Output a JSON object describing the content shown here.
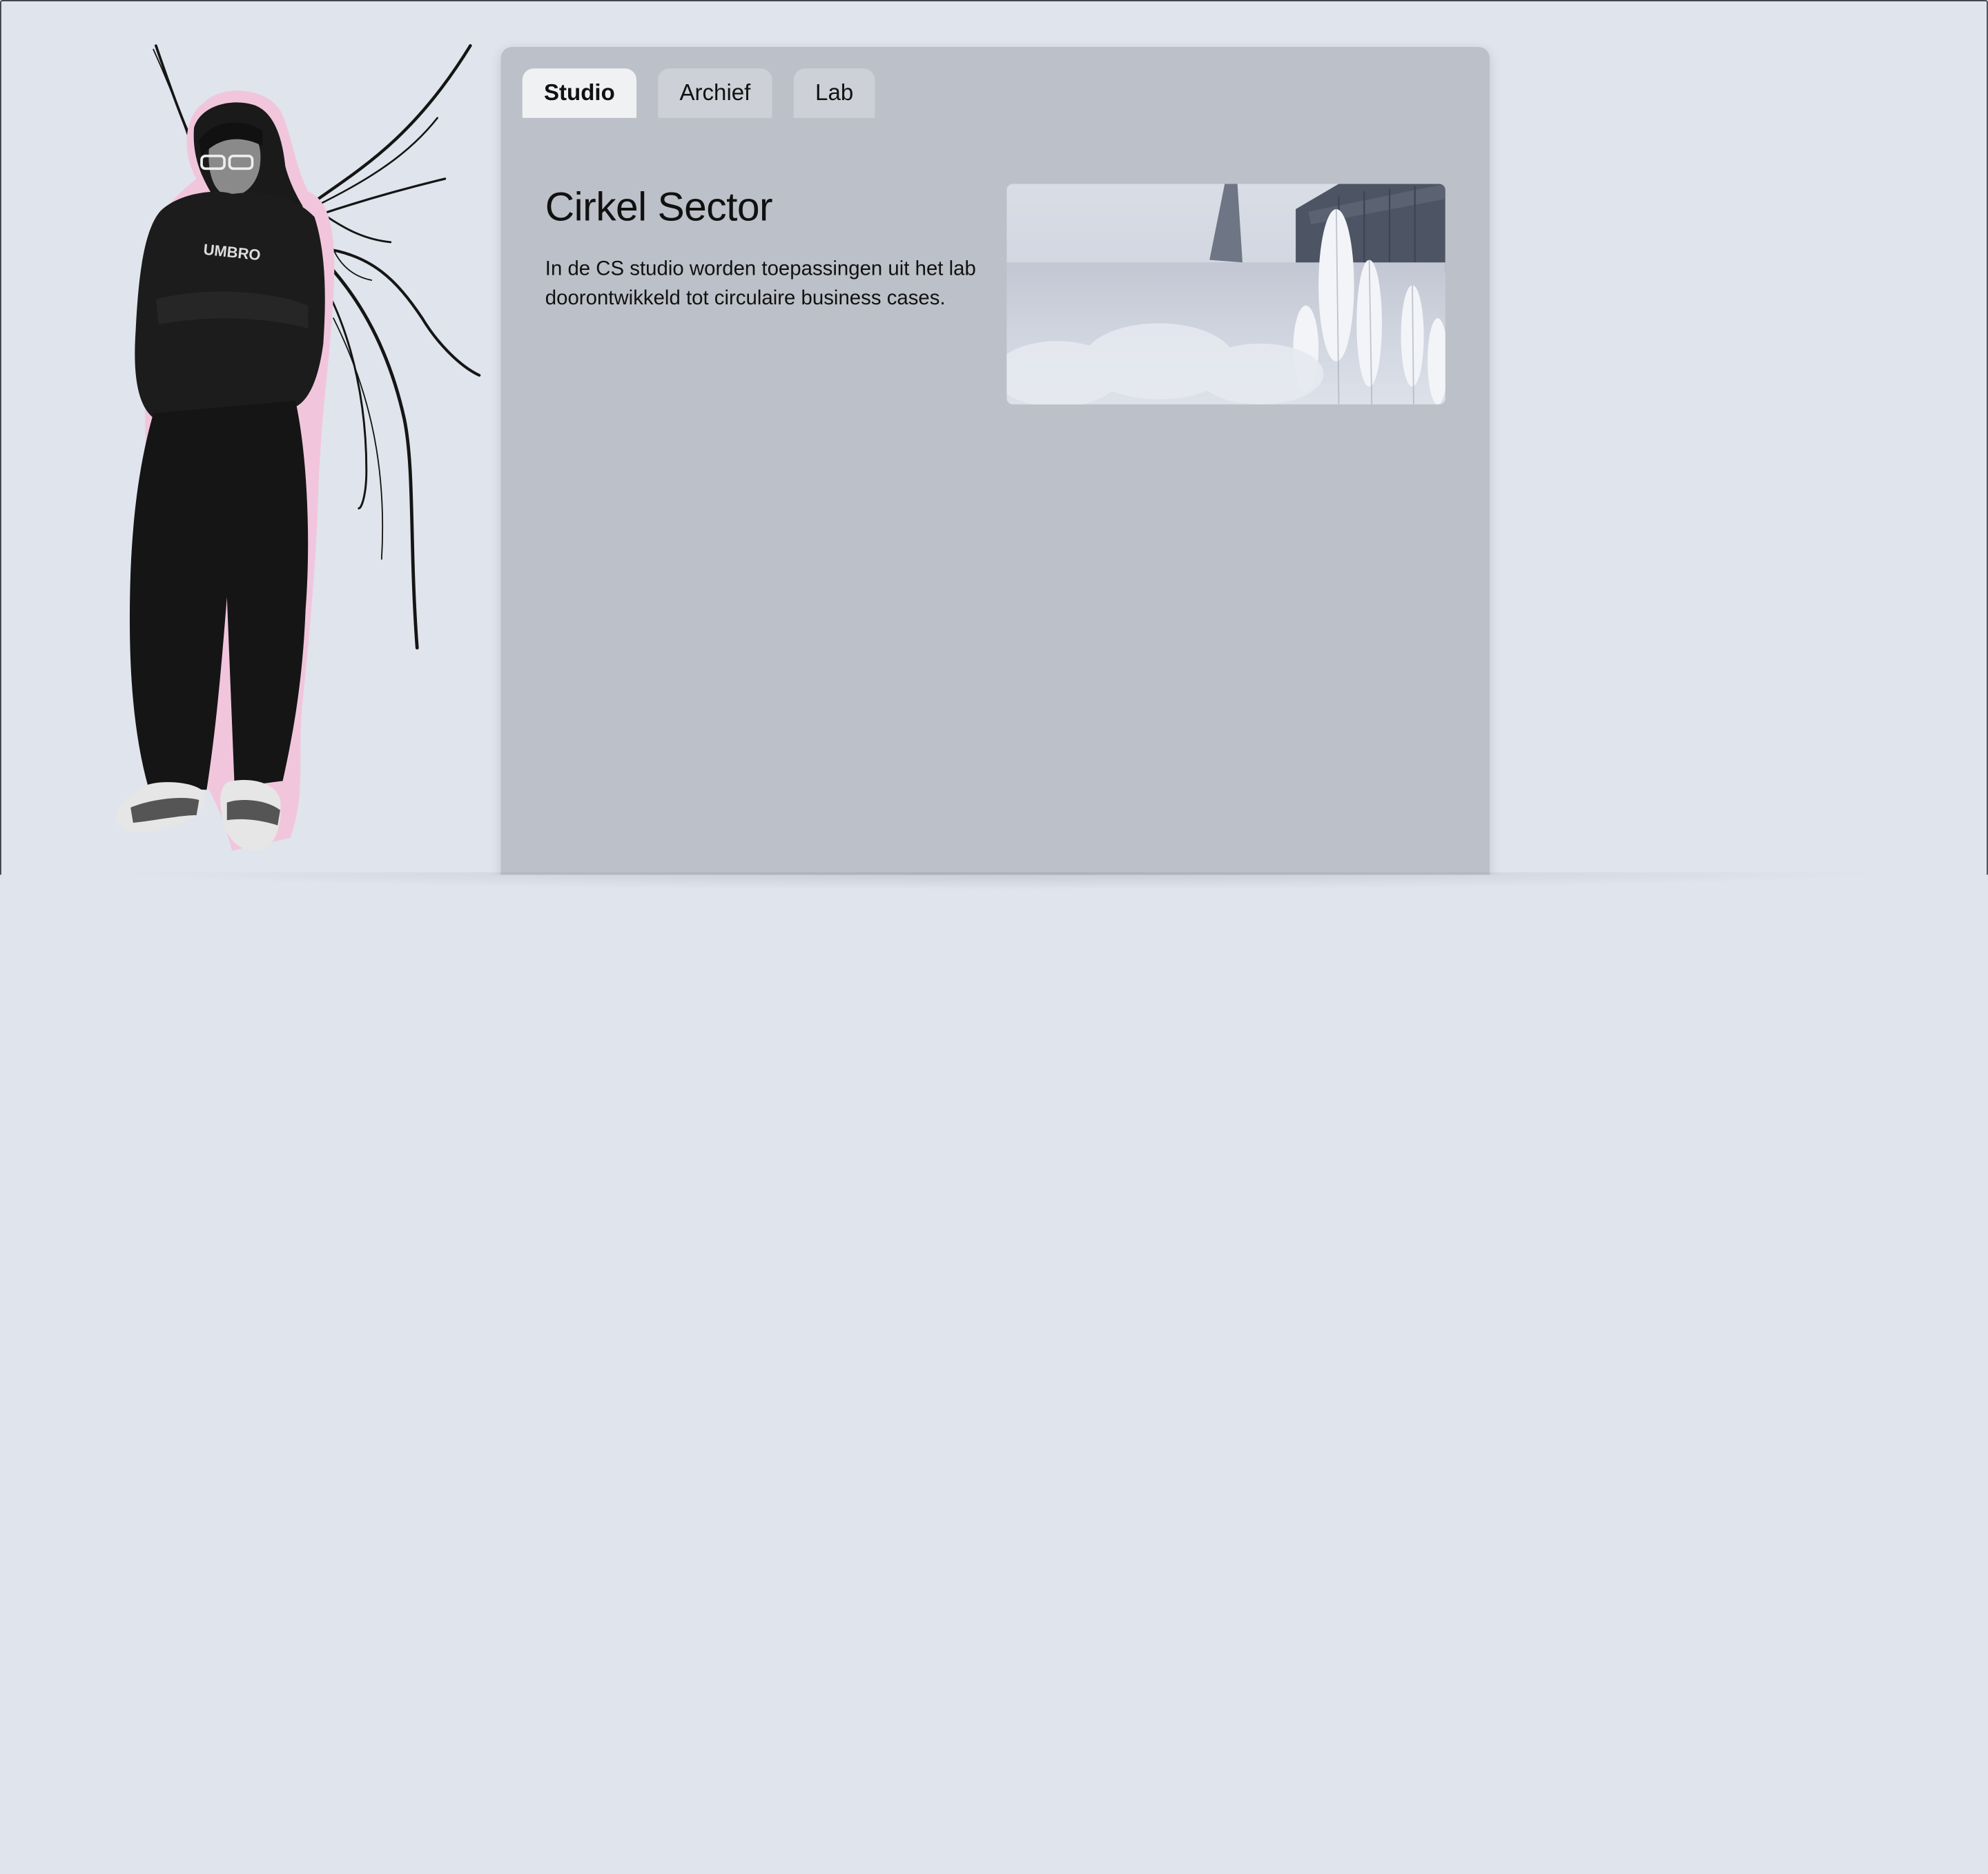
{
  "tabs": [
    {
      "label": "Studio",
      "active": true
    },
    {
      "label": "Archief",
      "active": false
    },
    {
      "label": "Lab",
      "active": false
    }
  ],
  "content": {
    "title": "Cirkel Sector",
    "text": "In de CS studio worden toepassingen uit het lab doorontwikkeld tot circulaire business cases."
  },
  "figure": {
    "sweater_text": "UMBRO",
    "icon": "person-with-wings-illustration"
  },
  "photo": {
    "icon": "frosted-field-photo"
  },
  "colors": {
    "background": "#e0e4ec",
    "panel": "#bcc0c8",
    "tab_active": "#f0f1f3",
    "tab_inactive": "#cdd0d7",
    "figure_outline": "#f1c6dc"
  }
}
